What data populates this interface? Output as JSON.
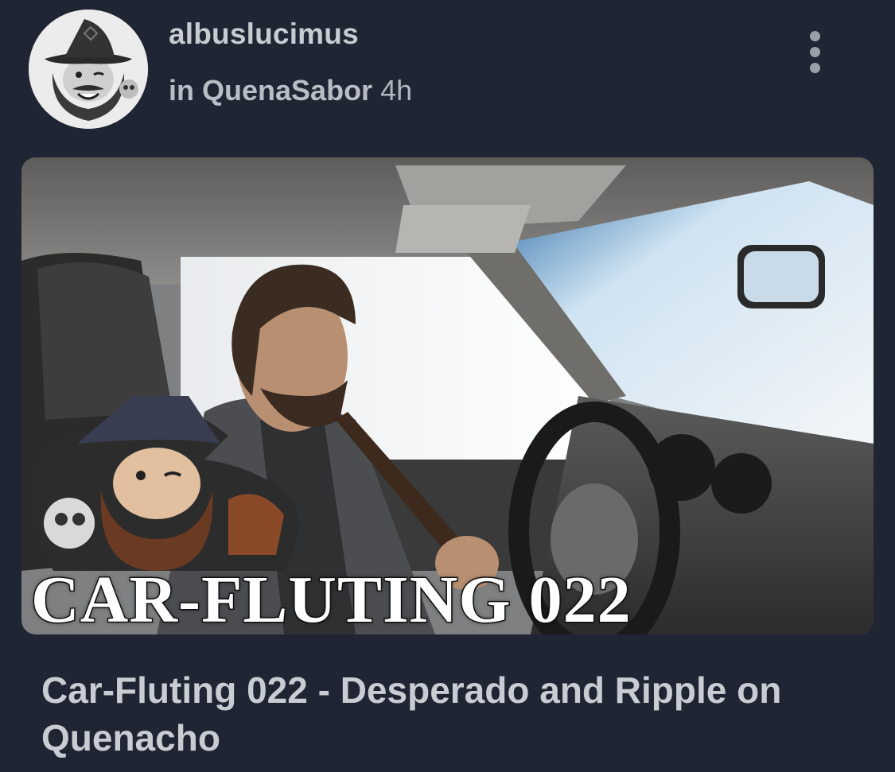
{
  "post": {
    "author": "albuslucimus",
    "community_prefix": "in",
    "community": "QuenaSabor",
    "time_ago": "4h",
    "thumbnail_caption": "CAR-FLUTING 022",
    "title": "Car-Fluting 022 - Desperado and Ripple on Quenacho"
  },
  "icons": {
    "more": "more-vertical-icon",
    "avatar": "wizard-avatar"
  },
  "colors": {
    "background": "#1f2532",
    "text_primary": "#c9ccd2",
    "text_secondary": "#b9bec6"
  }
}
